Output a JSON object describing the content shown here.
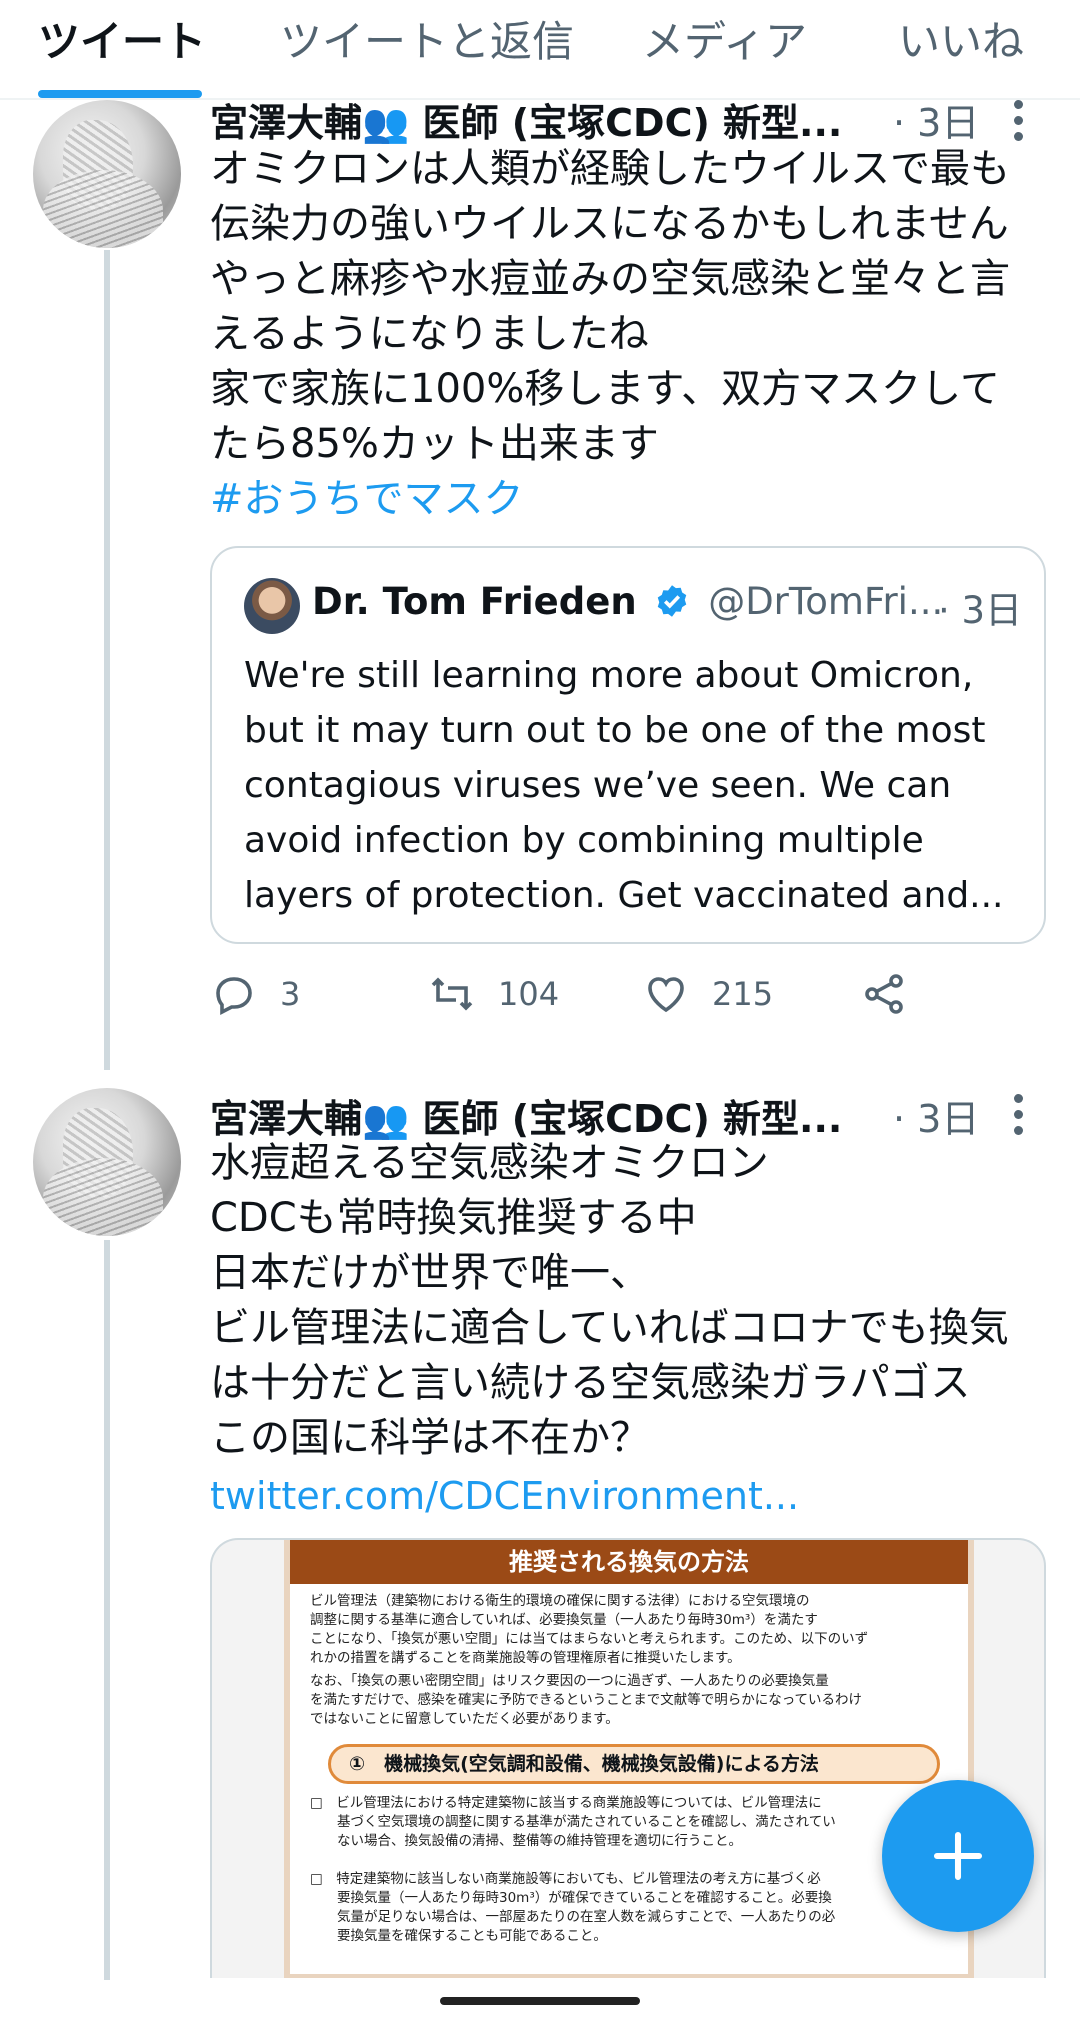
{
  "tabs": [
    {
      "label": "ツイート",
      "active": true
    },
    {
      "label": "ツイートと返信",
      "active": false
    },
    {
      "label": "メディア",
      "active": false
    },
    {
      "label": "いいね",
      "active": false
    }
  ],
  "tweet1": {
    "author": "宮澤大輔👥 医師 (宝塚CDC) 新型...",
    "time": "· 3日",
    "lines": [
      "オミクロンは人類が経験したウイルスで最も",
      "伝染力の強いウイルスになるかもしれません",
      "やっと麻疹や水痘並みの空気感染と堂々と言",
      "えるようになりましたね",
      "家で家族に100%移します、双方マスクして",
      "たら85%カット出来ます"
    ],
    "hashtag": "#おうちでマスク",
    "quote": {
      "name": "Dr. Tom Frieden",
      "handle": "@DrTomFri...",
      "time": "· 3日",
      "lines": [
        "We're still learning more about Omicron,",
        "but it may turn out to be one of the most",
        "contagious viruses we’ve seen. We can",
        "avoid infection by combining multiple",
        "layers of protection. Get vaccinated and..."
      ]
    },
    "replies": "3",
    "retweets": "104",
    "likes": "215"
  },
  "tweet2": {
    "author": "宮澤大輔👥 医師 (宝塚CDC) 新型...",
    "time": "· 3日",
    "lines": [
      "水痘超える空気感染オミクロン",
      "CDCも常時換気推奨する中",
      "日本だけが世界で唯一、",
      "ビル管理法に適合していればコロナでも換気",
      "は十分だと言い続ける空気感染ガラパゴス",
      "この国に科学は不在か？"
    ],
    "link": "twitter.com/CDCEnvironment...",
    "media": {
      "title": "推奨される換気の方法",
      "para1": [
        "ビル管理法（建築物における衛生的環境の確保に関する法律）における空気環境の",
        "調整に関する基準に適合していれば、必要換気量（一人あたり毎時30m³）を満たす",
        "ことになり、「換気が悪い空間」には当てはまらないと考えられます。このため、以下のいず",
        "れかの措置を講ずることを商業施設等の管理権原者に推奨いたします。"
      ],
      "para2": [
        "なお、「換気の悪い密閉空間」はリスク要因の一つに過ぎず、一人あたりの必要換気量",
        "を満たすだけで、感染を確実に予防できるということまで文献等で明らかになっているわけ",
        "ではないことに留意していただく必要があります。"
      ],
      "section": "①　機械換気(空気調和設備、機械換気設備)による方法",
      "bullet1": [
        "□　ビル管理法における特定建築物に該当する商業施設等については、ビル管理法に",
        "　　基づく空気環境の調整に関する基準が満たされていることを確認し、満たされてい",
        "　　ない場合、換気設備の清掃、整備等の維持管理を適切に行うこと。"
      ],
      "bullet2": [
        "□　特定建築物に該当しない商業施設等においても、ビル管理法の考え方に基づく必",
        "　　要換気量（一人あたり毎時30m³）が確保できていることを確認すること。必要換",
        "　　気量が足りない場合は、一部屋あたりの在室人数を減らすことで、一人あたりの必",
        "　　要換気量を確保することも可能であること。"
      ]
    }
  },
  "colors": {
    "accent": "#1d9bf0",
    "muted": "#536471",
    "text": "#0f1419"
  }
}
